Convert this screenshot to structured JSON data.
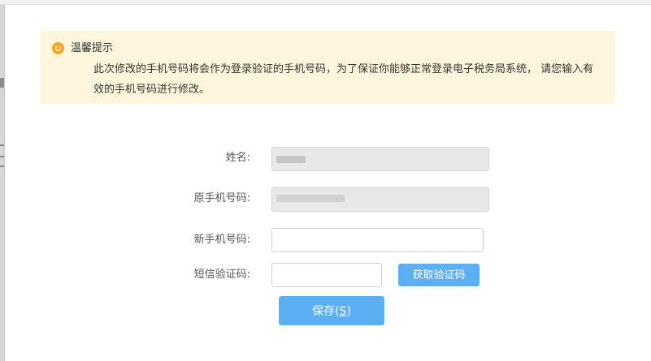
{
  "notice": {
    "icon": "smile-face-icon",
    "icon_color": "#f5a623",
    "background": "#fef6dc",
    "title": "温馨提示",
    "body": "此次修改的手机号码将会作为登录验证的手机号码，为了保证你能够正常登录电子税务局系统， 请您输入有效的手机号码进行修改。"
  },
  "form": {
    "name_label": "姓名:",
    "name_value": "",
    "old_phone_label": "原手机号码:",
    "old_phone_value": "",
    "new_phone_label": "新手机号码:",
    "new_phone_value": "",
    "sms_code_label": "短信验证码:",
    "sms_code_value": "",
    "get_code_button": "获取验证码",
    "save_button": "保存(",
    "save_hotkey": "S",
    "save_button_suffix": ")"
  },
  "colors": {
    "primary_button": "#5caff3",
    "readonly_field": "#e8e8e8"
  }
}
